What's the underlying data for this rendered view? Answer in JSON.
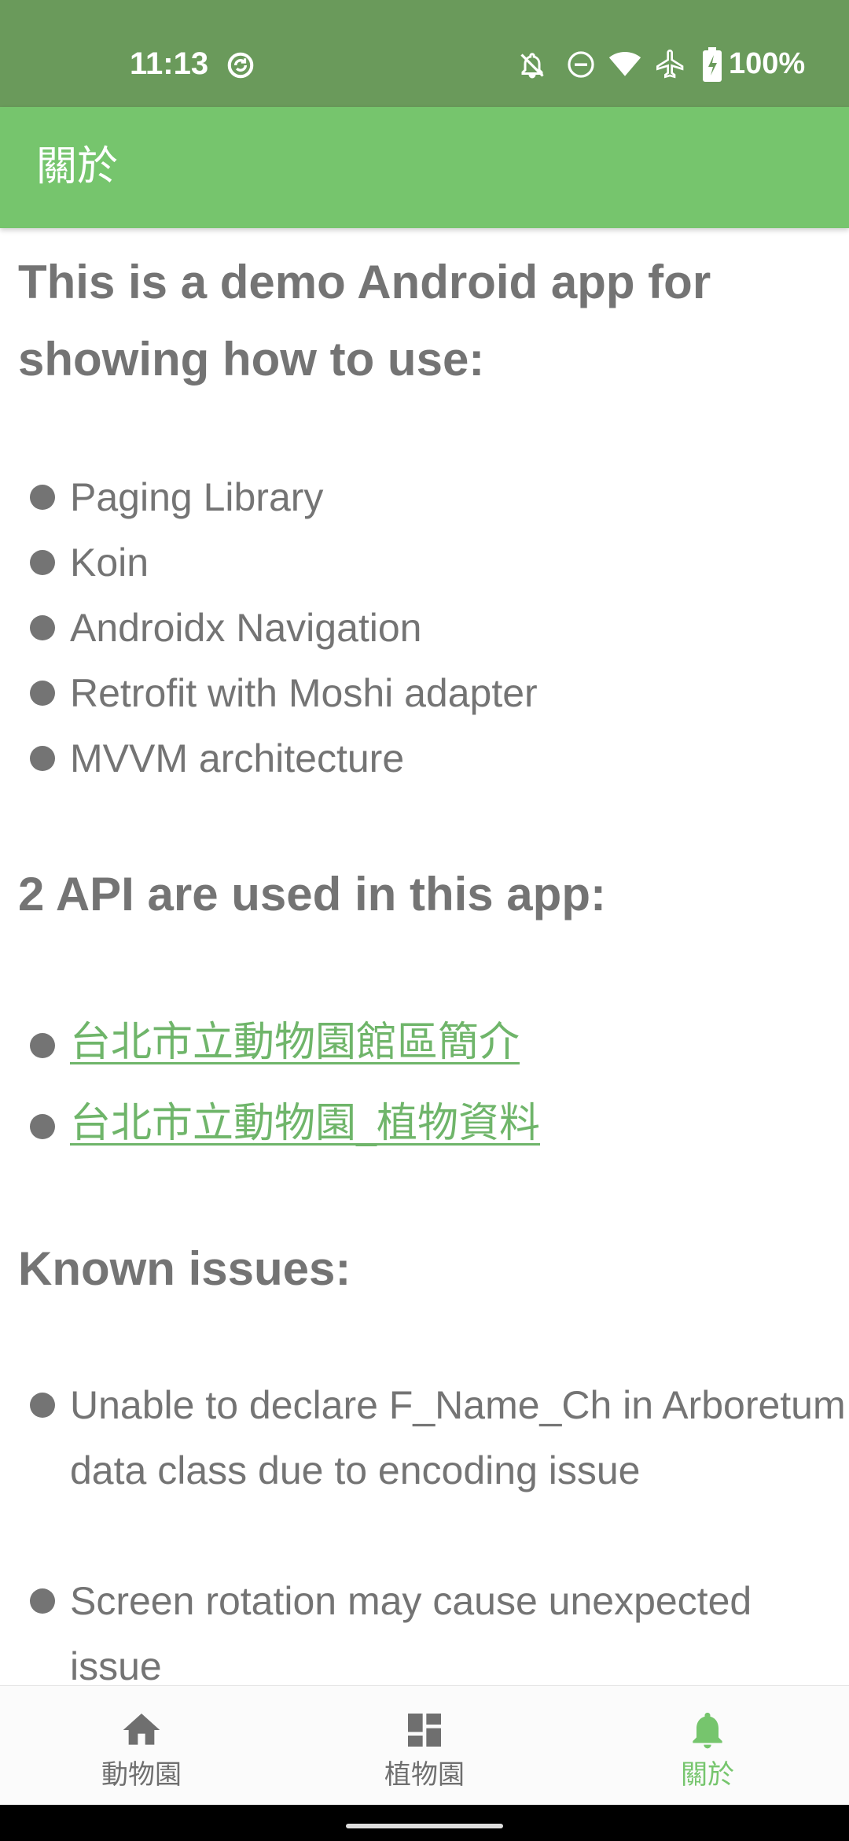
{
  "status_bar": {
    "time": "11:13",
    "battery": "100%",
    "icons": [
      "sync-icon",
      "bell-off-icon",
      "do-not-disturb-icon",
      "wifi-icon",
      "airplane-icon",
      "battery-charging-icon"
    ]
  },
  "app_bar": {
    "title": "關於"
  },
  "content": {
    "intro_heading": "This is a demo Android app for showing how to use:",
    "libraries": [
      "Paging Library",
      "Koin",
      "Androidx Navigation",
      "Retrofit with Moshi adapter",
      "MVVM architecture"
    ],
    "api_heading": "2 API are used in this app:",
    "api_links": [
      "台北市立動物園館區簡介",
      "台北市立動物園_植物資料"
    ],
    "issues_heading": "Known issues:",
    "issues": [
      "Unable to declare F_Name_Ch in Arboretum data class due to encoding issue",
      "Screen rotation may cause unexpected issue"
    ]
  },
  "bottom_nav": {
    "items": [
      {
        "label": "動物園",
        "icon": "home-icon",
        "active": false
      },
      {
        "label": "植物園",
        "icon": "dashboard-icon",
        "active": false
      },
      {
        "label": "關於",
        "icon": "bell-icon",
        "active": true
      }
    ]
  },
  "colors": {
    "status_bar": "#6a9a5b",
    "app_bar": "#76c56d",
    "accent": "#76c56d",
    "link": "#6fb56a",
    "text": "#747474"
  }
}
